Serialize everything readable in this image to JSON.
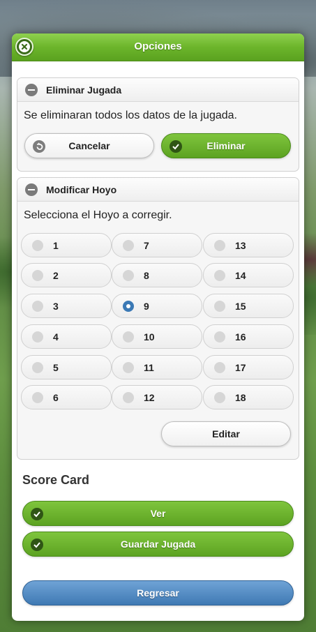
{
  "header": {
    "title": "Opciones"
  },
  "eliminar": {
    "title": "Eliminar Jugada",
    "text": "Se eliminaran todos los datos de la jugada.",
    "cancel_label": "Cancelar",
    "delete_label": "Eliminar"
  },
  "modificar": {
    "title": "Modificar Hoyo",
    "text": "Selecciona el Hoyo a corregir.",
    "holes": [
      "1",
      "2",
      "3",
      "4",
      "5",
      "6",
      "7",
      "8",
      "9",
      "10",
      "11",
      "12",
      "13",
      "14",
      "15",
      "16",
      "17",
      "18"
    ],
    "selected": "9",
    "edit_label": "Editar"
  },
  "scorecard": {
    "title": "Score Card",
    "view_label": "Ver",
    "save_label": "Guardar Jugada"
  },
  "footer": {
    "back_label": "Regresar"
  },
  "colors": {
    "accent_green": "#6cb52b",
    "accent_blue": "#3f79b3",
    "radio_selected": "#3b79b5"
  }
}
